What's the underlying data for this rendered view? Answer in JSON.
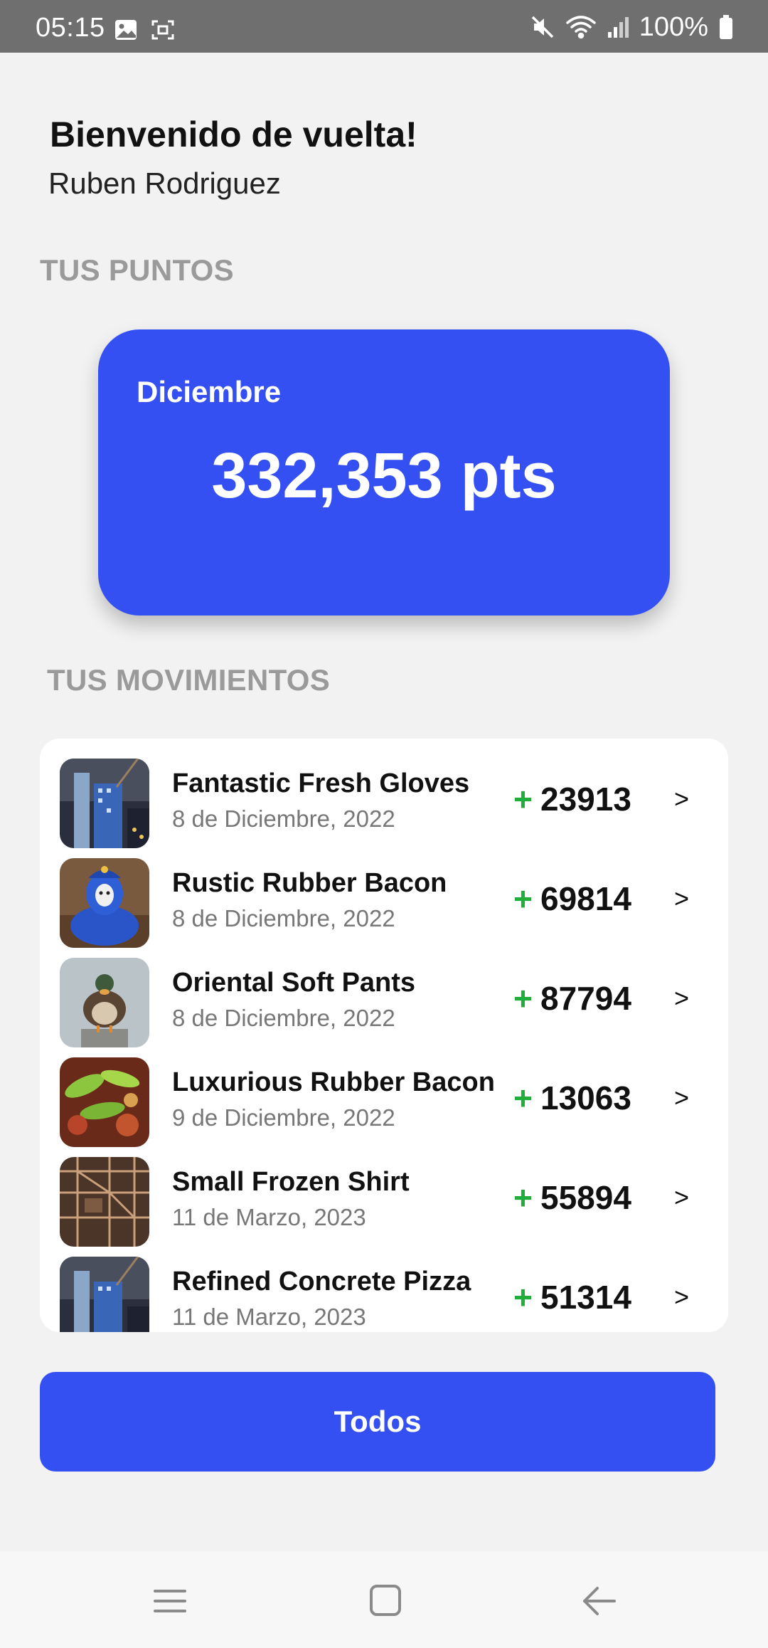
{
  "status_bar": {
    "time": "05:15",
    "battery": "100%",
    "left_icons": [
      "image-icon",
      "screenshot-icon"
    ],
    "right_icons": [
      "mute-icon",
      "wifi-icon",
      "signal-icon",
      "battery-icon"
    ]
  },
  "greeting": {
    "title": "Bienvenido de vuelta!",
    "name": "Ruben Rodriguez"
  },
  "points_section": {
    "label": "TUS PUNTOS",
    "month": "Diciembre",
    "points": "332,353 pts"
  },
  "movements_section": {
    "label": "TUS MOVIMIENTOS",
    "items": [
      {
        "name": "Fantastic Fresh Gloves",
        "date": "8 de Diciembre, 2022",
        "sign": "+",
        "amount": "23913",
        "chevron": ">",
        "thumb": "city-tower-image"
      },
      {
        "name": "Rustic Rubber Bacon",
        "date": "8 de Diciembre, 2022",
        "sign": "+",
        "amount": "69814",
        "chevron": ">",
        "thumb": "carnival-costume-image"
      },
      {
        "name": "Oriental Soft Pants",
        "date": "8 de Diciembre, 2022",
        "sign": "+",
        "amount": "87794",
        "chevron": ">",
        "thumb": "duck-image"
      },
      {
        "name": "Luxurious Rubber Bacon",
        "date": "9 de Diciembre, 2022",
        "sign": "+",
        "amount": "13063",
        "chevron": ">",
        "thumb": "food-image"
      },
      {
        "name": "Small Frozen Shirt",
        "date": "11 de Marzo, 2023",
        "sign": "+",
        "amount": "55894",
        "chevron": ">",
        "thumb": "industrial-image"
      },
      {
        "name": "Refined Concrete Pizza",
        "date": "11 de Marzo, 2023",
        "sign": "+",
        "amount": "51314",
        "chevron": ">",
        "thumb": "city-tower-image"
      }
    ]
  },
  "actions": {
    "all_button": "Todos"
  },
  "nav_bar": {
    "icons": [
      "recent-apps-icon",
      "home-icon",
      "back-icon"
    ]
  },
  "colors": {
    "accent": "#3450f2",
    "positive": "#1fae3b",
    "section_label": "#9a9a9a",
    "background": "#f2f2f2"
  }
}
